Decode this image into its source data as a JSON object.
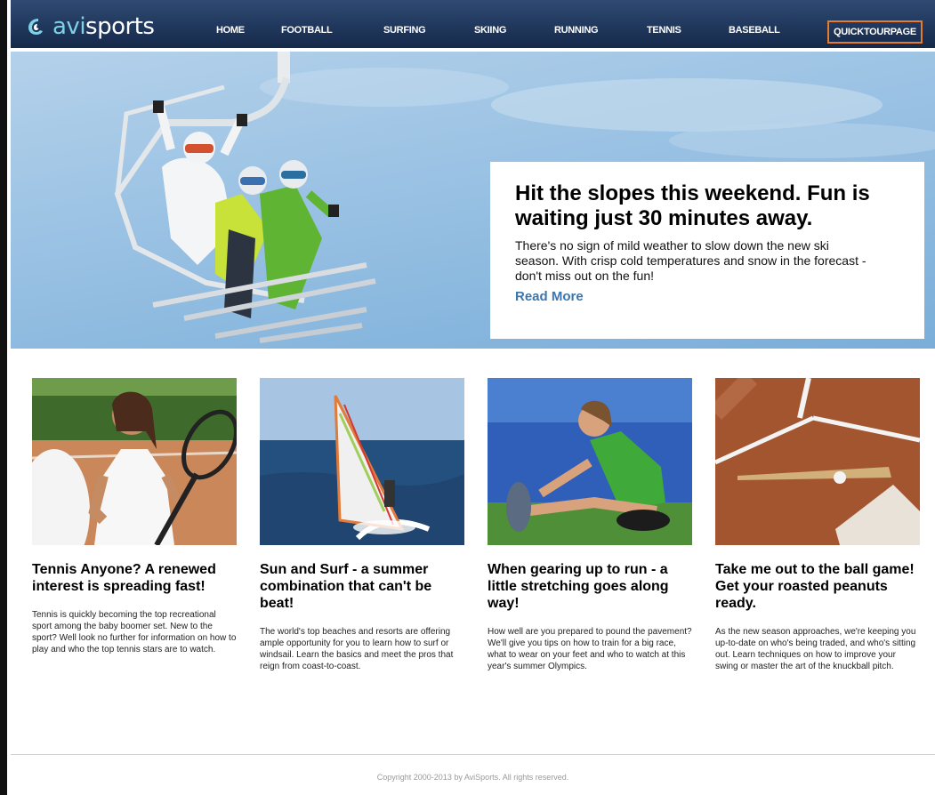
{
  "brand": {
    "logo_text_a": "avi",
    "logo_text_b": "sports"
  },
  "nav": {
    "items": [
      {
        "label": "HOME"
      },
      {
        "label": "FOOTBALL"
      },
      {
        "label": "SURFING"
      },
      {
        "label": "SKIING"
      },
      {
        "label": "RUNNING"
      },
      {
        "label": "TENNIS"
      },
      {
        "label": "BASEBALL"
      },
      {
        "label": "QUICKTOURPAGE"
      }
    ],
    "active_index": 7
  },
  "hero": {
    "title": "Hit the slopes this weekend. Fun is waiting just 30 minutes away.",
    "text": "There's no sign of mild weather to slow down the new ski season.  With crisp cold temperatures and snow in the forecast - don't miss out on the fun!",
    "link": "Read More"
  },
  "articles": [
    {
      "title": "Tennis Anyone? A renewed interest is spreading fast!",
      "text": "Tennis is quickly becoming the top recreational sport among the baby boomer set. New to the sport? Well look no further for information on how to play and who the top tennis stars are to watch."
    },
    {
      "title": "Sun and Surf - a summer combination that can't be beat!",
      "text": "The world's top beaches and resorts are offering ample opportunity for you to learn how to surf or windsail.  Learn the basics and meet the pros that reign from coast-to-coast."
    },
    {
      "title": "When gearing up to run - a little stretching goes along way!",
      "text": "How well are you prepared to pound the pavement? We'll give you tips on how to train for a big race, what to wear on your feet and who to watch at this year's summer Olympics."
    },
    {
      "title": "Take me out to the ball game! Get your roasted peanuts ready.",
      "text": "As the new season approaches, we're keeping you up-to-date on who's being traded, and who's sitting out. Learn techniques on how to improve your swing or master the art of the knuckball pitch."
    }
  ],
  "footer": {
    "copyright": "Copyright 2000-2013 by AviSports. All rights reserved."
  },
  "colors": {
    "nav_bg": "#1f365c",
    "active_border": "#e77a2c",
    "link": "#3a76b0"
  },
  "icons": [
    "logo-mark-icon"
  ]
}
